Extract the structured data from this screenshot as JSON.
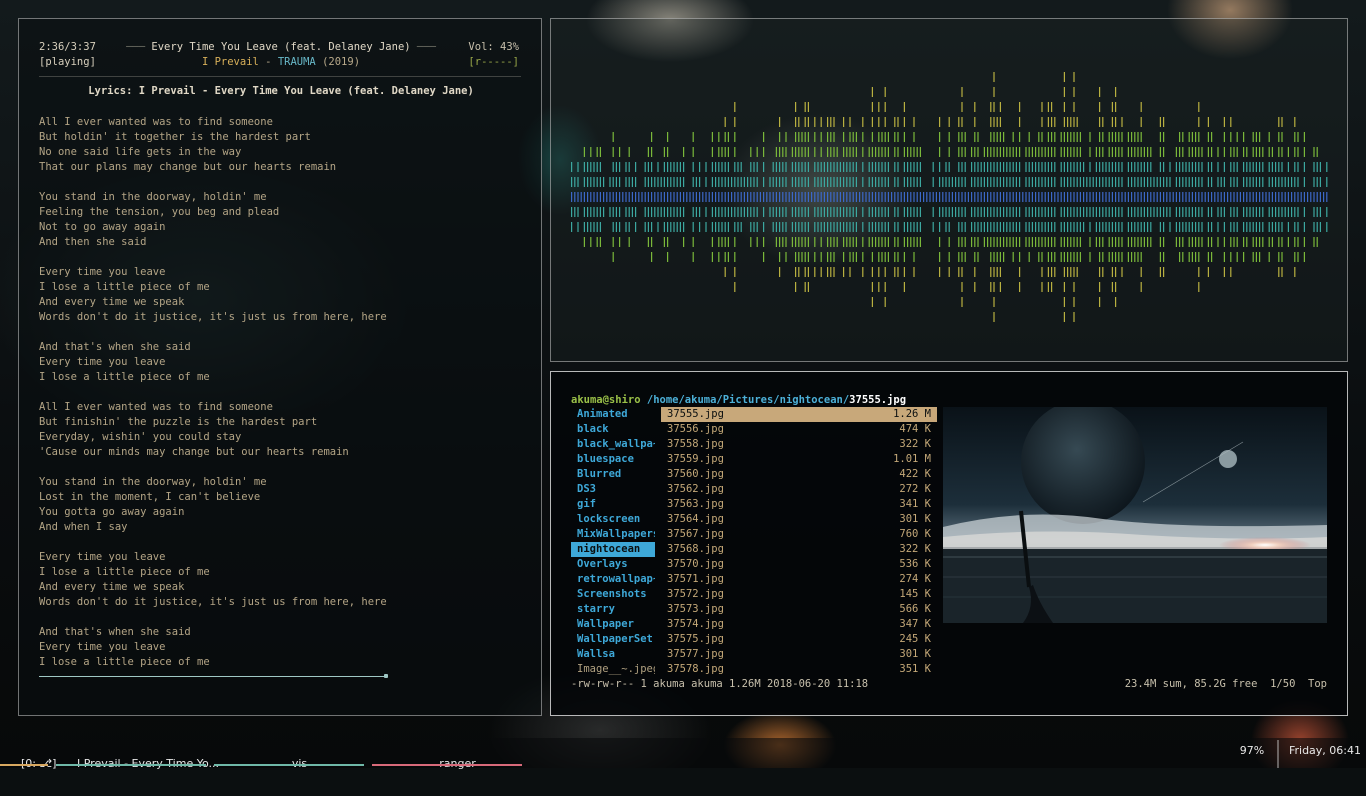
{
  "player": {
    "elapsed": "2:36/3:37",
    "state": "[playing]",
    "title": "Every Time You Leave (feat. Delaney Jane)",
    "artist": "I Prevail",
    "separator": " - ",
    "album": "TRAUMA",
    "year": "(2019)",
    "volume": "Vol: 43%",
    "flags": "[r-----]",
    "progress_fraction": 0.72
  },
  "lyrics": {
    "heading": "Lyrics: I Prevail - Every Time You Leave (feat. Delaney Jane)",
    "lines": [
      "All I ever wanted was to find someone",
      "But holdin' it together is the hardest part",
      "No one said life gets in the way",
      "That our plans may change but our hearts remain",
      "",
      "You stand in the doorway, holdin' me",
      "Feeling the tension, you beg and plead",
      "Not to go away again",
      "And then she said",
      "",
      "Every time you leave",
      "I lose a little piece of me",
      "And every time we speak",
      "Words don't do it justice, it's just us from here, here",
      "",
      "And that's when she said",
      "Every time you leave",
      "I lose a little piece of me",
      "",
      "All I ever wanted was to find someone",
      "But finishin' the puzzle is the hardest part",
      "Everyday, wishin' you could stay",
      "'Cause our minds may change but our hearts remain",
      "",
      "You stand in the doorway, holdin' me",
      "Lost in the moment, I can't believe",
      "You gotta go away again",
      "And when I say",
      "",
      "Every time you leave",
      "I lose a little piece of me",
      "And every time we speak",
      "Words don't do it justice, it's just us from here, here",
      "",
      "And that's when she said",
      "Every time you leave",
      "I lose a little piece of me"
    ]
  },
  "ranger": {
    "user_host": "akuma@shiro",
    "path_dir": "/home/akuma/Pictures/nightocean/",
    "path_file": "37555.jpg",
    "parent_dirs": [
      {
        "name": "Animated",
        "selected": false,
        "dir": true
      },
      {
        "name": "black",
        "selected": false,
        "dir": true
      },
      {
        "name": "black_wallpa~",
        "selected": false,
        "dir": true
      },
      {
        "name": "bluespace",
        "selected": false,
        "dir": true
      },
      {
        "name": "Blurred",
        "selected": false,
        "dir": true
      },
      {
        "name": "DS3",
        "selected": false,
        "dir": true
      },
      {
        "name": "gif",
        "selected": false,
        "dir": true
      },
      {
        "name": "lockscreen",
        "selected": false,
        "dir": true
      },
      {
        "name": "MixWallpapers",
        "selected": false,
        "dir": true
      },
      {
        "name": "nightocean",
        "selected": true,
        "dir": true
      },
      {
        "name": "Overlays",
        "selected": false,
        "dir": true
      },
      {
        "name": "retrowallpap~",
        "selected": false,
        "dir": true
      },
      {
        "name": "Screenshots",
        "selected": false,
        "dir": true
      },
      {
        "name": "starry",
        "selected": false,
        "dir": true
      },
      {
        "name": "Wallpaper",
        "selected": false,
        "dir": true
      },
      {
        "name": "WallpaperSet",
        "selected": false,
        "dir": true
      },
      {
        "name": "Wallsa",
        "selected": false,
        "dir": true
      },
      {
        "name": "Image__~.jpeg",
        "selected": false,
        "dir": false
      }
    ],
    "files": [
      {
        "name": "37555.jpg",
        "size": "1.26 M",
        "selected": true
      },
      {
        "name": "37556.jpg",
        "size": "474 K",
        "selected": false
      },
      {
        "name": "37558.jpg",
        "size": "322 K",
        "selected": false
      },
      {
        "name": "37559.jpg",
        "size": "1.01 M",
        "selected": false
      },
      {
        "name": "37560.jpg",
        "size": "422 K",
        "selected": false
      },
      {
        "name": "37562.jpg",
        "size": "272 K",
        "selected": false
      },
      {
        "name": "37563.jpg",
        "size": "341 K",
        "selected": false
      },
      {
        "name": "37564.jpg",
        "size": "301 K",
        "selected": false
      },
      {
        "name": "37567.jpg",
        "size": "760 K",
        "selected": false
      },
      {
        "name": "37568.jpg",
        "size": "322 K",
        "selected": false
      },
      {
        "name": "37570.jpg",
        "size": "536 K",
        "selected": false
      },
      {
        "name": "37571.jpg",
        "size": "274 K",
        "selected": false
      },
      {
        "name": "37572.jpg",
        "size": "145 K",
        "selected": false
      },
      {
        "name": "37573.jpg",
        "size": "566 K",
        "selected": false
      },
      {
        "name": "37574.jpg",
        "size": "347 K",
        "selected": false
      },
      {
        "name": "37575.jpg",
        "size": "245 K",
        "selected": false
      },
      {
        "name": "37577.jpg",
        "size": "301 K",
        "selected": false
      },
      {
        "name": "37578.jpg",
        "size": "351 K",
        "selected": false
      }
    ],
    "status_left": "-rw-rw-r-- 1 akuma akuma 1.26M 2018-06-20 11:18",
    "status_right": "23.4M sum, 85.2G free  1/50  Top"
  },
  "taskbar": {
    "workspace": "[0: ⎇]",
    "windows": [
      {
        "label": "I Prevail - Every Time Yo...",
        "color": "#6fb8a8"
      },
      {
        "label": "vis",
        "color": "#6fb8a8"
      },
      {
        "label": "ranger",
        "color": "#d86a7a"
      }
    ],
    "workspace_color": "#d8a860",
    "battery": "97%",
    "clock": "Friday, 06:41"
  },
  "colors": {
    "vis_green": "#7ab83a",
    "vis_teal": "#3ca8a0",
    "vis_blue": "#3c68c8",
    "vis_yellow": "#b8b040"
  }
}
